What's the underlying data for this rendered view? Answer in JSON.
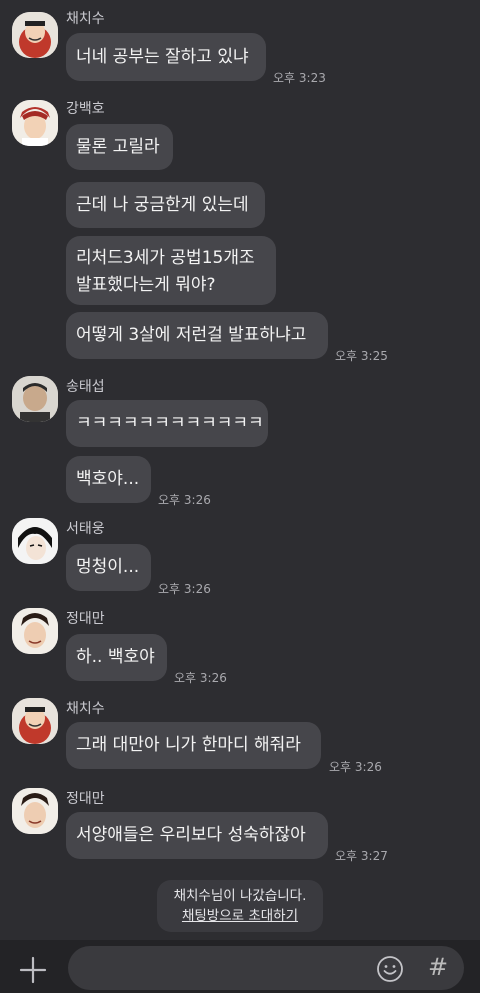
{
  "messages": [
    {
      "sender": "채치수",
      "text": "너네 공부는 잘하고 있냐",
      "time": "오후 3:23"
    },
    {
      "sender": "강백호",
      "texts": [
        "물론 고릴라",
        "근데 나 궁금한게 있는데",
        "리처드3세가 공법15개조",
        "발표했다는게 뭐야?",
        "어떻게 3살에 저런걸 발표하냐고"
      ],
      "time": "오후 3:25"
    },
    {
      "sender": "송태섭",
      "texts": [
        "ㅋㅋㅋㅋㅋㅋㅋㅋㅋㅋㅋㅋ",
        "백호야..."
      ],
      "time": "오후 3:26"
    },
    {
      "sender": "서태웅",
      "text": "멍청이...",
      "time": "오후 3:26"
    },
    {
      "sender": "정대만",
      "text": "하.. 백호야",
      "time": "오후 3:26"
    },
    {
      "sender": "채치수",
      "text": "그래 대만아 니가 한마디 해줘라",
      "time": "오후 3:26"
    },
    {
      "sender": "정대만",
      "text": "서양애들은 우리보다 성숙하잖아",
      "time": "오후 3:27"
    }
  ],
  "notice": {
    "text": "채치수님이 나갔습니다.",
    "link": "채팅방으로 초대하기"
  },
  "input": {
    "hash_symbol": "#",
    "icons": [
      "plus-icon",
      "emoji-icon",
      "hash-icon"
    ]
  },
  "colors": {
    "background": "#2d2d31",
    "bubble": "#46464b",
    "input_bar": "#232326"
  }
}
